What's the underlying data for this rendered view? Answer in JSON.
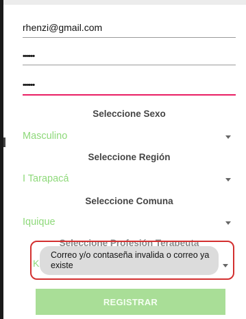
{
  "form": {
    "email_value": "rhenzi@gmail.com",
    "password_value": "••••••",
    "confirm_password_value": "••••••",
    "sex": {
      "label": "Seleccione Sexo",
      "selected": "Masculino"
    },
    "region": {
      "label": "Seleccione Región",
      "selected": "I Tarapacá"
    },
    "comuna": {
      "label": "Seleccione Comuna",
      "selected": "Iquique"
    },
    "profesion": {
      "label": "Seleccione Profesión Terapeuta",
      "selected": "Ki"
    },
    "register_label": "REGISTRAR"
  },
  "toast": {
    "message": "Correo y/o contaseña invalida o correo ya existe"
  },
  "colors": {
    "accent": "#e91e63",
    "spinner_text": "#8ed97a",
    "button_bg": "#a9de97",
    "highlight": "#d32f2f"
  }
}
